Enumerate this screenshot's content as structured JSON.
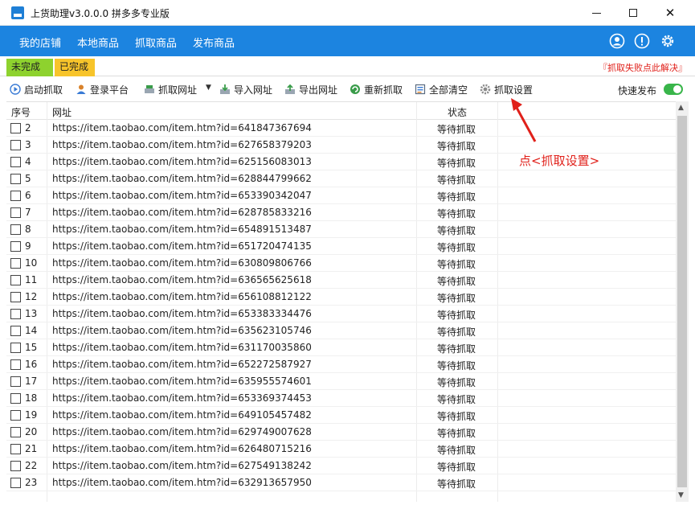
{
  "window": {
    "title": "上货助理v3.0.0.0 拼多多专业版",
    "minimize_icon": "minimize-icon",
    "maximize_icon": "maximize-icon",
    "close_glyph": "✕"
  },
  "menu": {
    "items": [
      "我的店铺",
      "本地商品",
      "抓取商品",
      "发布商品"
    ],
    "icons": [
      "user-icon",
      "info-icon",
      "gear-icon"
    ]
  },
  "tabs": {
    "pending": "未完成",
    "done": "已完成",
    "fail_link": "『抓取失败点此解决』"
  },
  "toolbar": {
    "start": "启动抓取",
    "login": "登录平台",
    "fetch_url": "抓取网址",
    "import": "导入网址",
    "export": "导出网址",
    "refetch": "重新抓取",
    "clear": "全部清空",
    "settings": "抓取设置",
    "fast_publish": "快速发布",
    "fast_publish_on": true
  },
  "table": {
    "headers": {
      "index": "序号",
      "url": "网址",
      "status": "状态"
    },
    "rows": [
      {
        "n": "2",
        "url": "https://item.taobao.com/item.htm?id=641847367694",
        "status": "等待抓取"
      },
      {
        "n": "3",
        "url": "https://item.taobao.com/item.htm?id=627658379203",
        "status": "等待抓取"
      },
      {
        "n": "4",
        "url": "https://item.taobao.com/item.htm?id=625156083013",
        "status": "等待抓取"
      },
      {
        "n": "5",
        "url": "https://item.taobao.com/item.htm?id=628844799662",
        "status": "等待抓取"
      },
      {
        "n": "6",
        "url": "https://item.taobao.com/item.htm?id=653390342047",
        "status": "等待抓取"
      },
      {
        "n": "7",
        "url": "https://item.taobao.com/item.htm?id=628785833216",
        "status": "等待抓取"
      },
      {
        "n": "8",
        "url": "https://item.taobao.com/item.htm?id=654891513487",
        "status": "等待抓取"
      },
      {
        "n": "9",
        "url": "https://item.taobao.com/item.htm?id=651720474135",
        "status": "等待抓取"
      },
      {
        "n": "10",
        "url": "https://item.taobao.com/item.htm?id=630809806766",
        "status": "等待抓取"
      },
      {
        "n": "11",
        "url": "https://item.taobao.com/item.htm?id=636565625618",
        "status": "等待抓取"
      },
      {
        "n": "12",
        "url": "https://item.taobao.com/item.htm?id=656108812122",
        "status": "等待抓取"
      },
      {
        "n": "13",
        "url": "https://item.taobao.com/item.htm?id=653383334476",
        "status": "等待抓取"
      },
      {
        "n": "14",
        "url": "https://item.taobao.com/item.htm?id=635623105746",
        "status": "等待抓取"
      },
      {
        "n": "15",
        "url": "https://item.taobao.com/item.htm?id=631170035860",
        "status": "等待抓取"
      },
      {
        "n": "16",
        "url": "https://item.taobao.com/item.htm?id=652272587927",
        "status": "等待抓取"
      },
      {
        "n": "17",
        "url": "https://item.taobao.com/item.htm?id=635955574601",
        "status": "等待抓取"
      },
      {
        "n": "18",
        "url": "https://item.taobao.com/item.htm?id=653369374453",
        "status": "等待抓取"
      },
      {
        "n": "19",
        "url": "https://item.taobao.com/item.htm?id=649105457482",
        "status": "等待抓取"
      },
      {
        "n": "20",
        "url": "https://item.taobao.com/item.htm?id=629749007628",
        "status": "等待抓取"
      },
      {
        "n": "21",
        "url": "https://item.taobao.com/item.htm?id=626480715216",
        "status": "等待抓取"
      },
      {
        "n": "22",
        "url": "https://item.taobao.com/item.htm?id=627549138242",
        "status": "等待抓取"
      },
      {
        "n": "23",
        "url": "https://item.taobao.com/item.htm?id=632913657950",
        "status": "等待抓取"
      }
    ]
  },
  "annotation": {
    "text": "点<抓取设置>"
  },
  "colors": {
    "menubar": "#1c84e0",
    "pending_tab": "#8ed22e",
    "done_tab": "#f7c42a",
    "alert_red": "#e0201a",
    "switch_on": "#39b54a"
  }
}
